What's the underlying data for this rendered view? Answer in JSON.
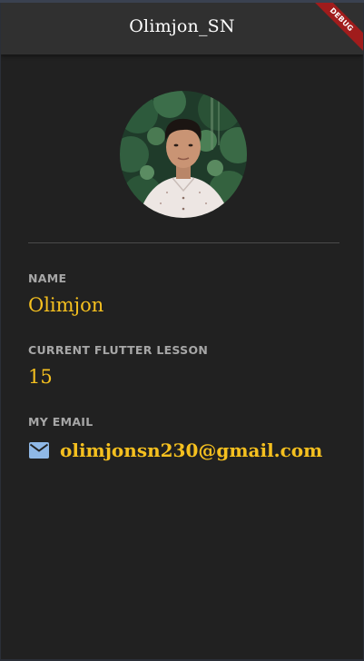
{
  "app_bar": {
    "title": "Olimjon_SN"
  },
  "debug_banner": {
    "label": "DEBUG"
  },
  "profile": {
    "avatar_icon": "profile-photo",
    "name_label": "NAME",
    "name_value": "Olimjon",
    "lesson_label": "CURRENT FLUTTER LESSON",
    "lesson_value": "15",
    "email_label": "MY EMAIL",
    "email_icon": "mail-icon",
    "email_value": "olimjonsn230@gmail.com"
  },
  "colors": {
    "background": "#212121",
    "app_bar": "#303030",
    "accent": "#f5c01f",
    "label": "#a7a7a7",
    "divider": "#4a4a4a",
    "mail_icon": "#8fb8e6",
    "debug_ribbon": "#a01c1c"
  }
}
